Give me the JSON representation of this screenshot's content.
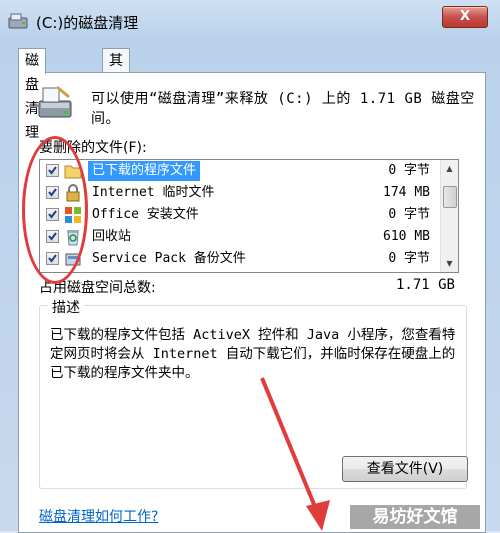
{
  "window": {
    "title": "(C:)的磁盘清理",
    "close_label": "X"
  },
  "tabs": [
    {
      "label": "磁盘清理"
    },
    {
      "label": "其他选项"
    }
  ],
  "summary": {
    "text": "可以使用“磁盘清理”来释放 (C:) 上的 1.71 GB 磁盘空间。"
  },
  "files": {
    "label": "要删除的文件(F):",
    "items": [
      {
        "name": "已下载的程序文件",
        "size": "0 字节",
        "checked": true,
        "icon": "folder-icon"
      },
      {
        "name": "Internet 临时文件",
        "size": "174 MB",
        "checked": true,
        "icon": "lock-icon"
      },
      {
        "name": "Office 安装文件",
        "size": "0 字节",
        "checked": true,
        "icon": "office-icon"
      },
      {
        "name": "回收站",
        "size": "610 MB",
        "checked": true,
        "icon": "recycle-bin-icon"
      },
      {
        "name": "Service Pack 备份文件",
        "size": "0 字节",
        "checked": true,
        "icon": "backup-icon"
      }
    ]
  },
  "total": {
    "label": "占用磁盘空间总数:",
    "value": "1.71 GB"
  },
  "description": {
    "legend": "描述",
    "text": "已下载的程序文件包括 ActiveX 控件和 Java 小程序，您查看特定网页时将会从 Internet 自动下载它们，并临时保存在硬盘上的已下载的程序文件夹中。",
    "view_files_button": "查看文件(V)"
  },
  "help_link": "磁盘清理如何工作?",
  "watermark": "易坊好文馆",
  "colors": {
    "selection": "#3399ff",
    "annotation": "#e03c3c",
    "link": "#0066cc"
  }
}
